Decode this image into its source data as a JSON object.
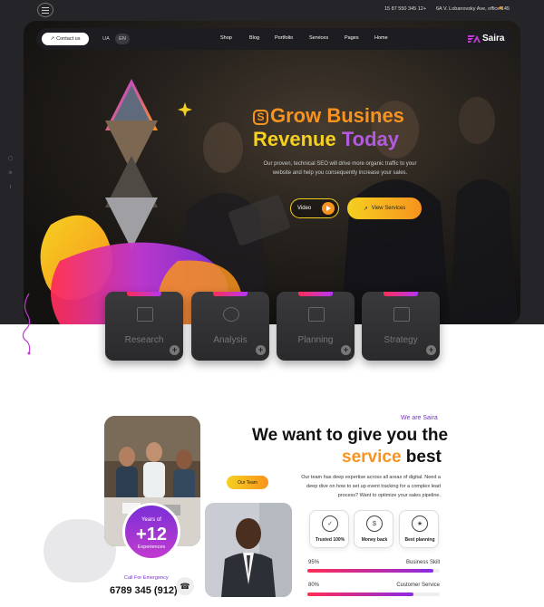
{
  "topbar": {
    "phone": "15 87 550 345 12+",
    "address": "6A V. Lobanovsky Ave, office 145"
  },
  "nav": {
    "contact_label": "Contact us",
    "languages": [
      "UA",
      "EN"
    ],
    "active_language": "EN",
    "items": [
      "Shop",
      "Blog",
      "Portfolio",
      "Services",
      "Pages",
      "Home"
    ],
    "logo_text": "Saira"
  },
  "hero": {
    "badge": "S",
    "title_line1": "Grow Busines",
    "title_line2a": "Revenue ",
    "title_line2b": "Today",
    "description": "Our proven, technical SEO will drive more organic traffic to your website and help you consequently increase your sales.",
    "video_label": "Video",
    "services_label": "View Services"
  },
  "service_cards": [
    {
      "label": "Research",
      "icon": "presentation-icon"
    },
    {
      "label": "Analysis",
      "icon": "magnifier-chart-icon"
    },
    {
      "label": "Planning",
      "icon": "pie-chart-icon"
    },
    {
      "label": "Strategy",
      "icon": "line-chart-icon"
    }
  ],
  "about": {
    "tag": "We are Saira",
    "heading_line1": "We want to give you the",
    "heading_line2a": "service",
    "heading_line2b": " best",
    "paragraph": "Our team has deep expertise across all areas of digital. Need a deep dive on how to set up event tracking for a complex lead process? Want to optimize your sales pipeline.",
    "team_label": "Our Team",
    "experience": {
      "prefix": "Years of",
      "value": "+12",
      "suffix": "Experiences"
    },
    "call_label": "Call For Emergency",
    "call_number": "6789 345 (912)"
  },
  "features": [
    {
      "label": "Trusted 100%",
      "icon": "hand-badge-icon"
    },
    {
      "label": "Money back",
      "icon": "money-hand-icon"
    },
    {
      "label": "Best planning",
      "icon": "trophy-icon"
    }
  ],
  "skills": [
    {
      "name": "Business Skill",
      "percent_label": "95%",
      "value": 0.95
    },
    {
      "name": "Customer Service",
      "percent_label": "80%",
      "value": 0.8
    }
  ],
  "colors": {
    "accent_orange": "#f7931e",
    "accent_yellow": "#f5d020",
    "accent_purple": "#7b2fd6",
    "dark_bg": "#252428"
  }
}
